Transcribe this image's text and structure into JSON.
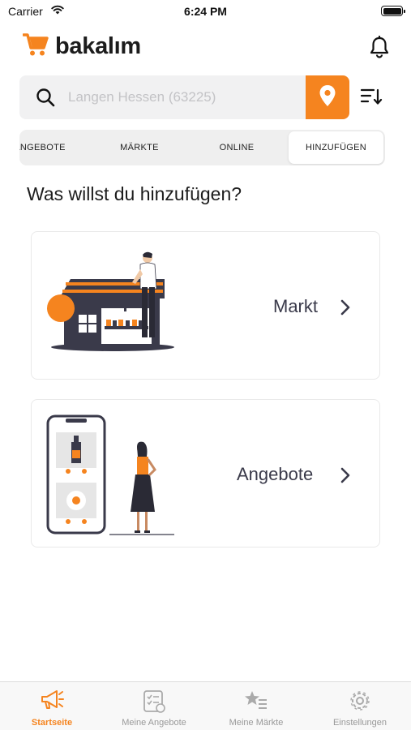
{
  "status": {
    "carrier": "Carrier",
    "time": "6:24 PM"
  },
  "header": {
    "logo_text": "bakalım"
  },
  "search": {
    "placeholder": "Langen Hessen (63225)",
    "value": ""
  },
  "tabs": [
    {
      "label": "ANGEBOTE",
      "active": false
    },
    {
      "label": "MÄRKTE",
      "active": false
    },
    {
      "label": "ONLINE",
      "active": false
    },
    {
      "label": "HINZUFÜGEN",
      "active": true
    }
  ],
  "main": {
    "question": "Was willst du hinzufügen?",
    "cards": [
      {
        "label": "Markt",
        "illustration": "store-illustration"
      },
      {
        "label": "Angebote",
        "illustration": "phone-offers-illustration"
      }
    ]
  },
  "tabbar": [
    {
      "label": "Startseite",
      "icon": "megaphone-icon",
      "active": true
    },
    {
      "label": "Meine Angebote",
      "icon": "checklist-icon",
      "active": false
    },
    {
      "label": "Meine Märkte",
      "icon": "star-list-icon",
      "active": false
    },
    {
      "label": "Einstellungen",
      "icon": "gear-icon",
      "active": false
    }
  ],
  "colors": {
    "accent": "#f5841f",
    "dark": "#3a3a4a",
    "inactive": "#999999"
  }
}
